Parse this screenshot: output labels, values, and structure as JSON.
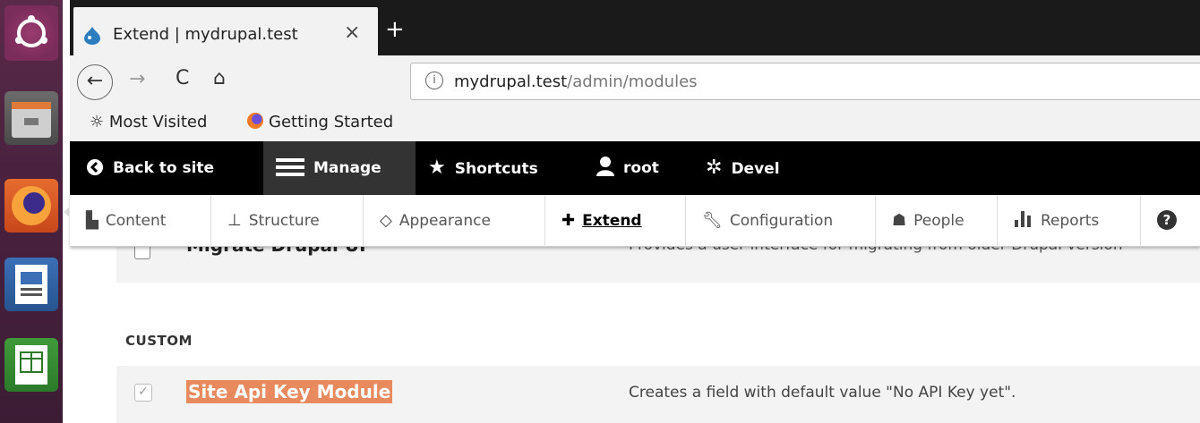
{
  "browser": {
    "tab_title": "Extend | mydrupal.test",
    "tab_close": "×",
    "new_tab": "+",
    "url_host": "mydrupal.test",
    "url_path": "/admin/modules",
    "nav": {
      "back": "←",
      "forward": "→",
      "reload": "C",
      "home": "⌂",
      "info": "i"
    },
    "bookmarks": [
      {
        "label": "Most Visited",
        "icon": "gear-icon"
      },
      {
        "label": "Getting Started",
        "icon": "firefox-icon"
      }
    ]
  },
  "toolbar": {
    "back": "Back to site",
    "manage": "Manage",
    "shortcuts": "Shortcuts",
    "user": "root",
    "devel": "Devel"
  },
  "tray": {
    "content": "Content",
    "structure": "Structure",
    "appearance": "Appearance",
    "extend": "Extend",
    "configuration": "Configuration",
    "people": "People",
    "reports": "Reports",
    "help": "?"
  },
  "modules": {
    "migrate": {
      "name": "Migrate Drupal UI",
      "description": "Provides a user interface for migrating from older Drupal version"
    },
    "custom_heading": "CUSTOM",
    "site_api": {
      "name": "Site Api Key Module",
      "checked_glyph": "✓",
      "description": "Creates a field with default value \"No API Key yet\"."
    }
  },
  "colors": {
    "toolbar_bg": "#000000",
    "highlight": "#e8895e",
    "launcher": "#4a2240"
  }
}
